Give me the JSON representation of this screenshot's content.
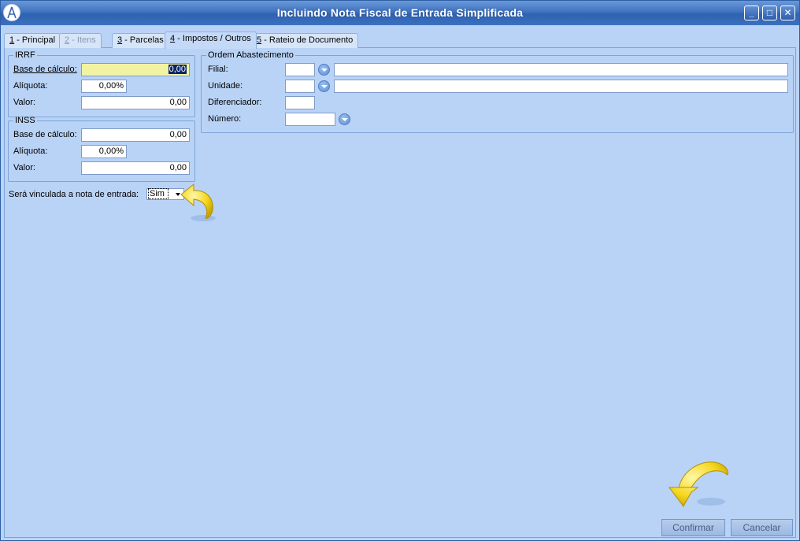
{
  "window": {
    "title": "Incluindo Nota Fiscal de Entrada Simplificada",
    "minimize": "_",
    "maximize": "□",
    "close": "✕"
  },
  "tabs": [
    {
      "key": "1",
      "label": " - Principal",
      "disabled": false,
      "active": false
    },
    {
      "key": "2",
      "label": " - Itens",
      "disabled": true,
      "active": false
    },
    {
      "key": "3",
      "label": " - Parcelas",
      "disabled": false,
      "active": false
    },
    {
      "key": "4",
      "label": " - Impostos / Outros",
      "disabled": false,
      "active": true
    },
    {
      "key": "5",
      "label": " - Rateio de Documento",
      "disabled": false,
      "active": false
    }
  ],
  "irrf": {
    "legend": "IRRF",
    "base_label": "Base de cálculo:",
    "base_value": "0,00",
    "aliquota_label": "Alíquota:",
    "aliquota_value": "0,00%",
    "valor_label": "Valor:",
    "valor_value": "0,00"
  },
  "inss": {
    "legend": "INSS",
    "base_label": "Base de cálculo:",
    "base_value": "0,00",
    "aliquota_label": "Alíquota:",
    "aliquota_value": "0,00%",
    "valor_label": "Valor:",
    "valor_value": "0,00"
  },
  "vinculada": {
    "label": "Será vinculada a nota de entrada:",
    "value": "Sim"
  },
  "ordem": {
    "legend": "Ordem Abastecimento",
    "filial_label": "Filial:",
    "unidade_label": "Unidade:",
    "diferenciador_label": "Diferenciador:",
    "numero_label": "Número:"
  },
  "buttons": {
    "confirmar": "Confirmar",
    "cancelar": "Cancelar"
  },
  "colors": {
    "background": "#b9d3f6",
    "titlebar": "#3f73c1",
    "highlight_field": "#f1f3a3",
    "annotation_arrow": "#f3d51f"
  },
  "icons": {
    "app_logo": "compass-logo-icon",
    "annotation": "yellow-curved-arrow-icon",
    "dropdown": "chevron-down-circle-icon"
  }
}
